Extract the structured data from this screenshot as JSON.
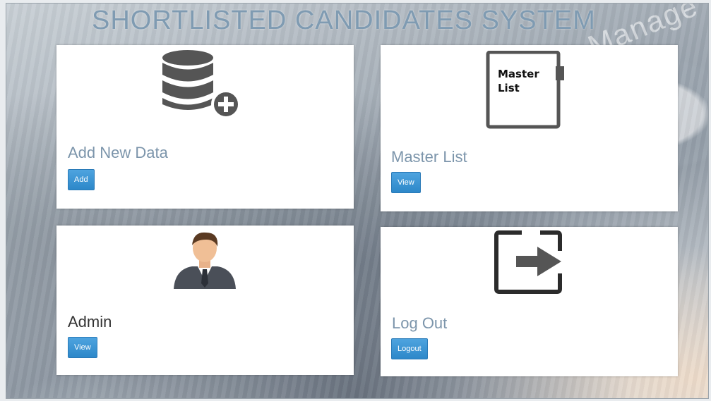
{
  "header": {
    "title": "SHORTLISTED CANDIDATES SYSTEM",
    "watermark": "Manage"
  },
  "cards": [
    {
      "heading": "Add New Data",
      "button": "Add",
      "icon": "database-add-icon"
    },
    {
      "heading": "Master List",
      "button": "View",
      "icon": "clipboard-icon",
      "icon_text": "Master List"
    },
    {
      "heading": "Admin",
      "button": "View",
      "icon": "user-avatar-icon"
    },
    {
      "heading": "Log Out",
      "button": "Logout",
      "icon": "logout-icon"
    }
  ],
  "colors": {
    "heading_blue": "#7c95ab",
    "heading_dark": "#333333",
    "button_blue": "#3a95d4",
    "icon_gray": "#555555"
  }
}
